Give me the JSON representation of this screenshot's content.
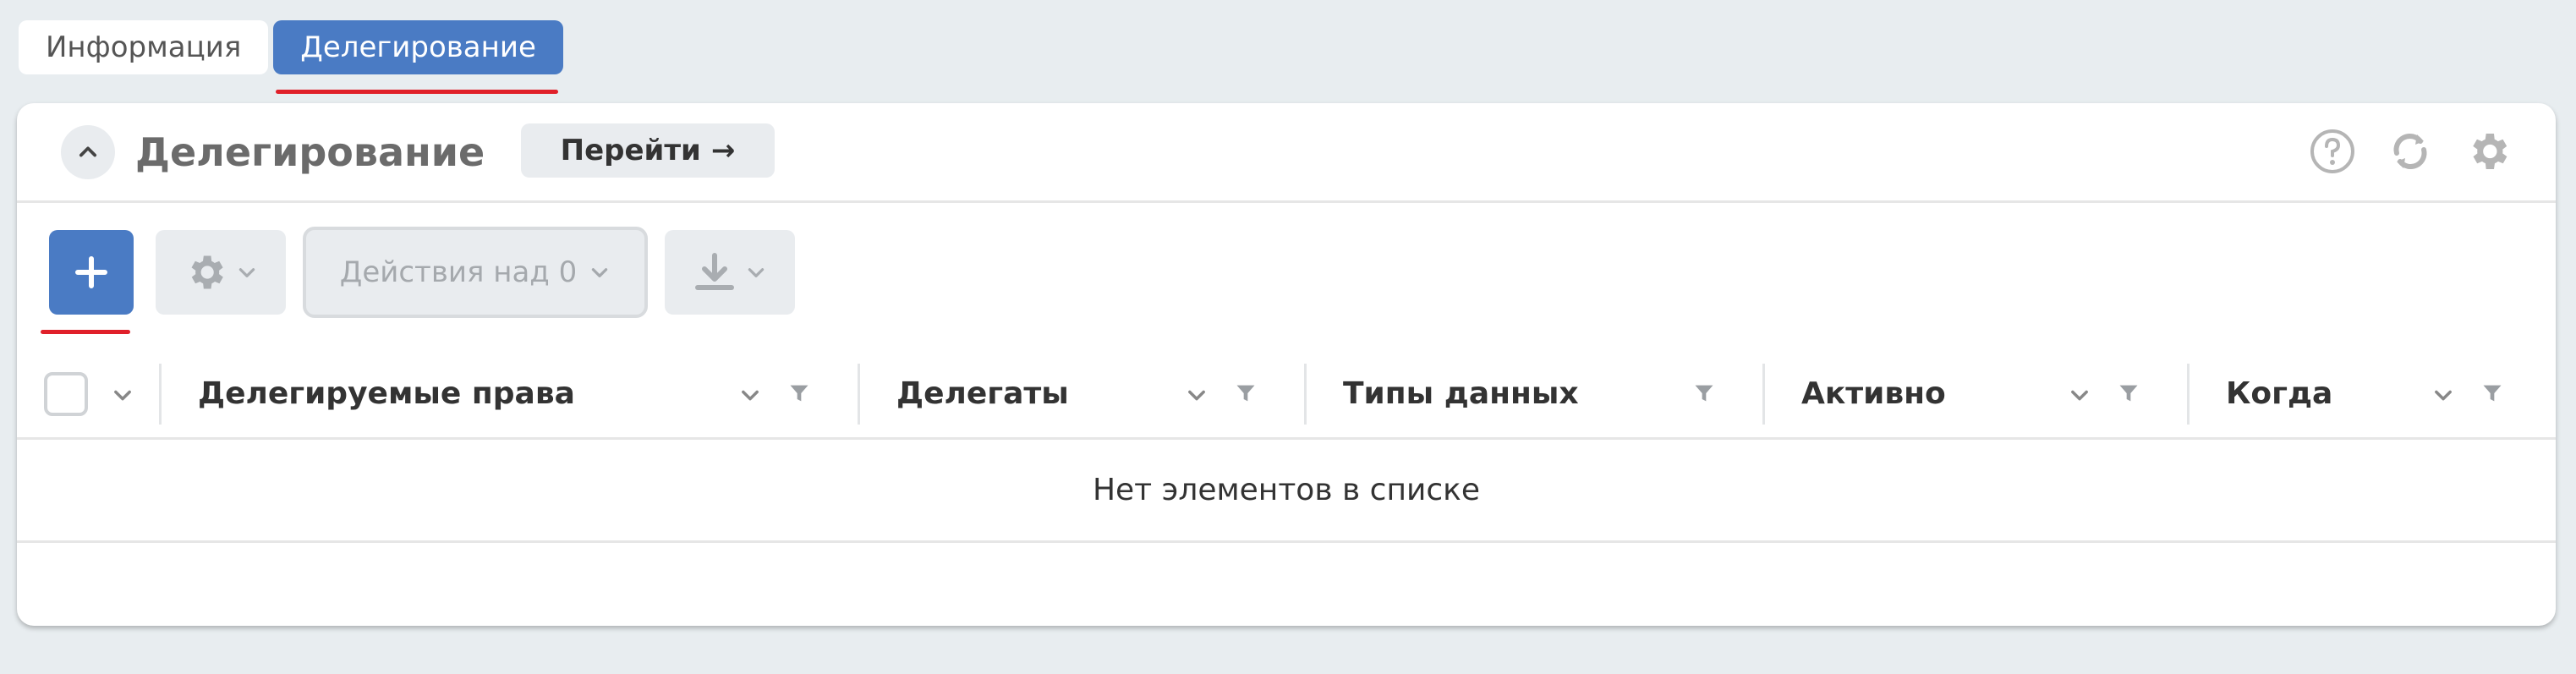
{
  "tabs": [
    {
      "label": "Информация",
      "active": false
    },
    {
      "label": "Делегирование",
      "active": true
    }
  ],
  "panel": {
    "title": "Делегирование",
    "goto_label": "Перейти",
    "goto_arrow": "→"
  },
  "toolbar": {
    "add_symbol": "+",
    "actions_label": "Действия над 0"
  },
  "table": {
    "columns": [
      {
        "label": "Делегируемые права"
      },
      {
        "label": "Делегаты"
      },
      {
        "label": "Типы данных"
      },
      {
        "label": "Активно"
      },
      {
        "label": "Когда"
      }
    ],
    "empty_text": "Нет элементов в списке"
  },
  "colors": {
    "accent": "#4a7bc4",
    "highlight_underline": "#e0202a",
    "background": "#e8edf0"
  },
  "icons": [
    "chevron-up-icon",
    "arrow-right-icon",
    "help-icon",
    "refresh-icon",
    "settings-gear-icon",
    "plus-icon",
    "gear-icon",
    "chevron-down-icon",
    "download-icon",
    "filter-icon"
  ]
}
